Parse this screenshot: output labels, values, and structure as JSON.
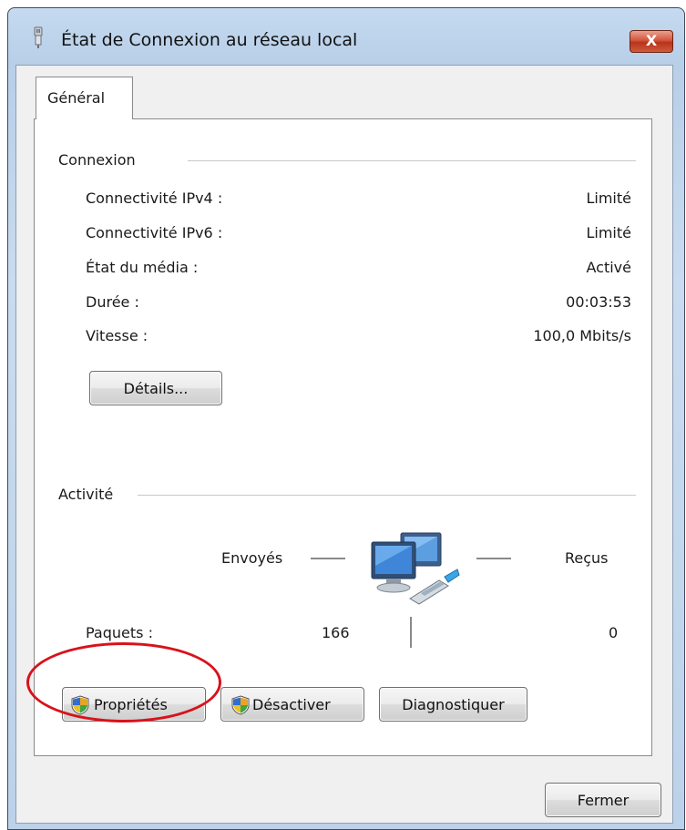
{
  "window": {
    "title": "État de Connexion au réseau local",
    "close_label": "X"
  },
  "tabs": [
    {
      "label": "Général"
    }
  ],
  "connexion": {
    "group_title": "Connexion",
    "properties": [
      {
        "label": "Connectivité IPv4 :",
        "value": "Limité"
      },
      {
        "label": "Connectivité IPv6 :",
        "value": "Limité"
      },
      {
        "label": "État du média :",
        "value": "Activé"
      },
      {
        "label": "Durée :",
        "value": "00:03:53"
      },
      {
        "label": "Vitesse :",
        "value": "100,0 Mbits/s"
      }
    ],
    "details_button": "Détails..."
  },
  "activite": {
    "group_title": "Activité",
    "sent_label": "Envoyés",
    "received_label": "Reçus",
    "packets_label": "Paquets :",
    "packets_sent": "166",
    "packets_received": "0",
    "icon": "network-computers-icon"
  },
  "actions": {
    "properties_button": "Propriétés",
    "disable_button": "Désactiver",
    "diagnose_button": "Diagnostiquer",
    "shield_icon": "uac-shield-icon"
  },
  "footer": {
    "close_button": "Fermer"
  },
  "colors": {
    "annotation_circle": "#d8121b",
    "titlebar": "#c5daf0"
  }
}
